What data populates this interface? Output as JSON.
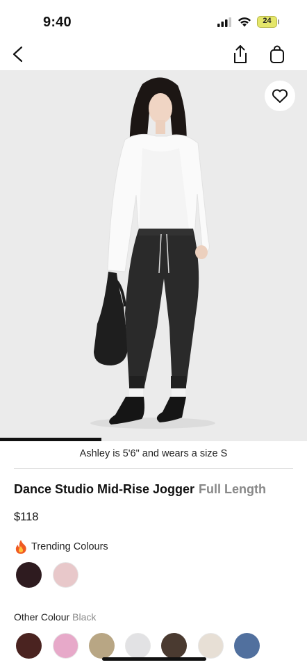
{
  "status_bar": {
    "time": "9:40",
    "battery": "24"
  },
  "nav": {
    "back_icon": "chevron-left-icon",
    "share_icon": "share-icon",
    "bag_icon": "shopping-bag-icon"
  },
  "product_image": {
    "wishlist_icon": "heart-icon",
    "gallery_progress": 0.33
  },
  "model_note": "Ashley is 5'6\" and wears a size S",
  "product": {
    "name": "Dance Studio Mid-Rise Jogger",
    "length": "Full Length",
    "price": "$118"
  },
  "trending": {
    "icon": "fire-icon",
    "label": "Trending Colours",
    "swatches": [
      {
        "name": "trending-swatch-1",
        "color": "#2e1b1f"
      },
      {
        "name": "trending-swatch-2",
        "color": "#e8c8ca"
      }
    ]
  },
  "other_colours": {
    "label": "Other Colour",
    "selected": "Black",
    "swatches": [
      {
        "name": "colour-swatch-1",
        "color": "#4a2320"
      },
      {
        "name": "colour-swatch-2",
        "color": "#e7a9c9"
      },
      {
        "name": "colour-swatch-3",
        "color": "#b8a684"
      },
      {
        "name": "colour-swatch-4",
        "color": "#e2e2e4"
      },
      {
        "name": "colour-swatch-5",
        "color": "#4a3a30"
      },
      {
        "name": "colour-swatch-6",
        "color": "#e7dfd5"
      },
      {
        "name": "colour-swatch-7",
        "color": "#51709e"
      }
    ]
  }
}
